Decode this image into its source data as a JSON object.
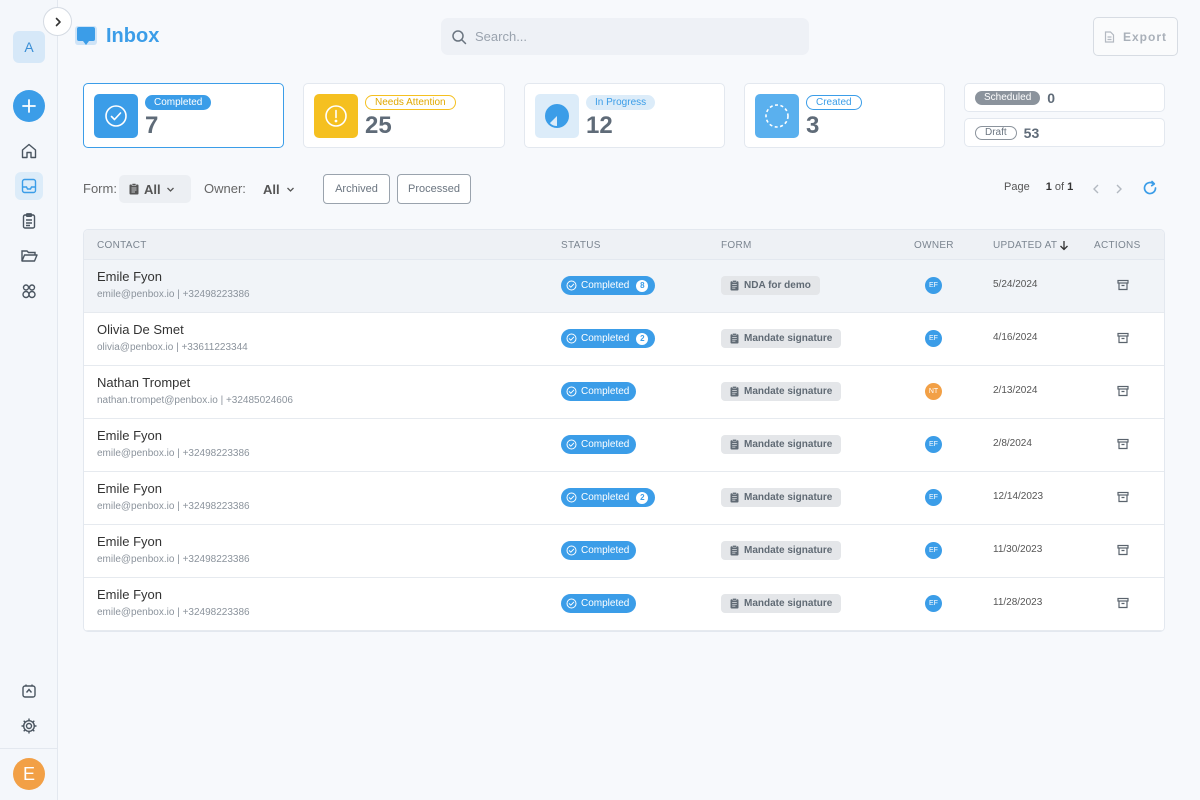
{
  "workspace": {
    "initial": "A"
  },
  "user": {
    "initial": "E"
  },
  "header": {
    "title": "Inbox",
    "search_placeholder": "Search...",
    "export_label": "Export"
  },
  "stats": [
    {
      "label": "Completed",
      "value": "7"
    },
    {
      "label": "Needs Attention",
      "value": "25"
    },
    {
      "label": "In Progress",
      "value": "12"
    },
    {
      "label": "Created",
      "value": "3"
    }
  ],
  "mini_stats": [
    {
      "label": "Scheduled",
      "value": "0"
    },
    {
      "label": "Draft",
      "value": "53"
    }
  ],
  "filters": {
    "form_label": "Form:",
    "form_value": "All",
    "owner_label": "Owner:",
    "owner_value": "All",
    "archived_label": "Archived",
    "processed_label": "Processed"
  },
  "pagination": {
    "label": "Page",
    "current": "1",
    "of_text": "of",
    "total": "1"
  },
  "table": {
    "columns": [
      "CONTACT",
      "STATUS",
      "FORM",
      "OWNER",
      "UPDATED AT",
      "ACTIONS"
    ],
    "rows": [
      {
        "name": "Emile Fyon",
        "sub": "emile@penbox.io | +32498223386",
        "status": "Completed",
        "count": "8",
        "form": "NDA for demo",
        "owner": "EF",
        "updated": "5/24/2024"
      },
      {
        "name": "Olivia De Smet",
        "sub": "olivia@penbox.io | +33611223344",
        "status": "Completed",
        "count": "2",
        "form": "Mandate signature",
        "owner": "EF",
        "updated": "4/16/2024"
      },
      {
        "name": "Nathan Trompet",
        "sub": "nathan.trompet@penbox.io | +32485024606",
        "status": "Completed",
        "count": "",
        "form": "Mandate signature",
        "owner": "NT",
        "updated": "2/13/2024"
      },
      {
        "name": "Emile Fyon",
        "sub": "emile@penbox.io | +32498223386",
        "status": "Completed",
        "count": "",
        "form": "Mandate signature",
        "owner": "EF",
        "updated": "2/8/2024"
      },
      {
        "name": "Emile Fyon",
        "sub": "emile@penbox.io | +32498223386",
        "status": "Completed",
        "count": "2",
        "form": "Mandate signature",
        "owner": "EF",
        "updated": "12/14/2023"
      },
      {
        "name": "Emile Fyon",
        "sub": "emile@penbox.io | +32498223386",
        "status": "Completed",
        "count": "",
        "form": "Mandate signature",
        "owner": "EF",
        "updated": "11/30/2023"
      },
      {
        "name": "Emile Fyon",
        "sub": "emile@penbox.io | +32498223386",
        "status": "Completed",
        "count": "",
        "form": "Mandate signature",
        "owner": "EF",
        "updated": "11/28/2023"
      }
    ]
  },
  "colors": {
    "accent": "#3b9de8",
    "warning": "#f5c020",
    "owner_ef": "#3b9de8",
    "owner_nt": "#f2a046"
  }
}
